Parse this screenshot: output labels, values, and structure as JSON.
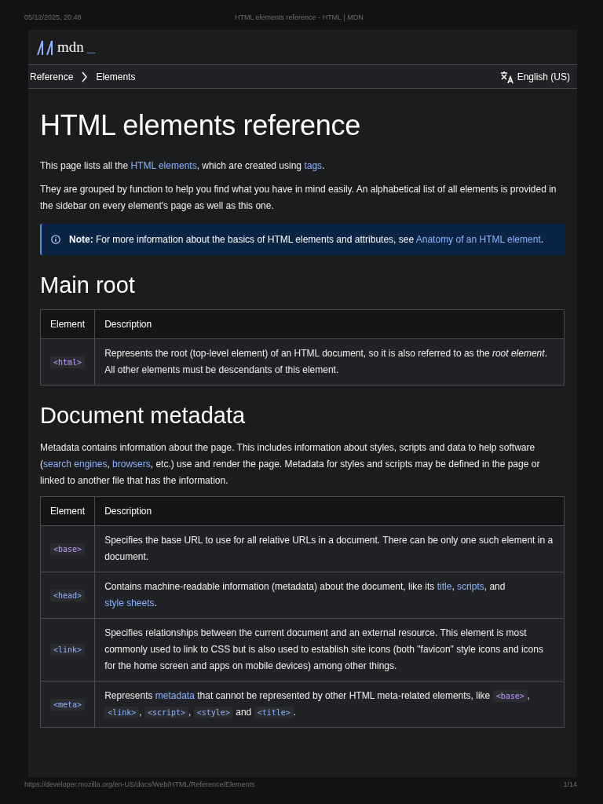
{
  "print_header": {
    "date": "05/12/2025, 20:48",
    "title": "HTML elements reference - HTML | MDN"
  },
  "site_header": {
    "logo_text": "mdn",
    "logo_cursor": "_"
  },
  "breadcrumbs": [
    {
      "label": "Reference"
    },
    {
      "label": "Elements"
    }
  ],
  "language": "English (US)",
  "title": "HTML elements reference",
  "intro": [
    [
      {
        "kind": "text",
        "text": "This page lists all the "
      },
      {
        "kind": "link",
        "text": "HTML elements",
        "visited": false
      },
      {
        "kind": "text",
        "text": ", which are created using "
      },
      {
        "kind": "link",
        "text": "tags",
        "visited": false
      },
      {
        "kind": "text",
        "text": "."
      }
    ],
    [
      {
        "kind": "text",
        "text": "They are grouped by function to help you find what you have in mind easily. An alphabetical list of all elements is provided in the sidebar on every element's page as well as this one."
      }
    ]
  ],
  "note": {
    "label": "Note:",
    "segments": [
      {
        "kind": "text",
        "text": " For more information about the basics of HTML elements and attributes, see "
      },
      {
        "kind": "link",
        "text": "Anatomy of an HTML element",
        "visited": false
      },
      {
        "kind": "text",
        "text": "."
      }
    ]
  },
  "sections": [
    {
      "heading": "Main root",
      "table": {
        "columns": [
          "Element",
          "Description"
        ],
        "rows": [
          {
            "element": {
              "text": "<html>",
              "visited": true
            },
            "description": [
              {
                "kind": "text",
                "text": "Represents the root (top-level element) of an HTML document, so it is also referred to as the "
              },
              {
                "kind": "em",
                "text": "root element"
              },
              {
                "kind": "text",
                "text": ". All other elements must be descendants of this element."
              }
            ]
          }
        ]
      }
    },
    {
      "heading": "Document metadata",
      "paragraphs": [
        [
          {
            "kind": "text",
            "text": "Metadata contains information about the page. This includes information about styles, scripts and data to help software ("
          },
          {
            "kind": "link",
            "text": "search engines",
            "visited": false
          },
          {
            "kind": "text",
            "text": ", "
          },
          {
            "kind": "link",
            "text": "browsers",
            "visited": false
          },
          {
            "kind": "text",
            "text": ", etc.) use and render the page. Metadata for styles and scripts may be defined in the page or linked to another file that has the information."
          }
        ]
      ],
      "table": {
        "columns": [
          "Element",
          "Description"
        ],
        "rows": [
          {
            "element": {
              "text": "<base>",
              "visited": true
            },
            "description": [
              {
                "kind": "text",
                "text": "Specifies the base URL to use for all relative URLs in a document. There can be only one such element in a document."
              }
            ]
          },
          {
            "element": {
              "text": "<head>",
              "visited": false
            },
            "description": [
              {
                "kind": "text",
                "text": "Contains machine-readable information (metadata) about the document, like its "
              },
              {
                "kind": "link",
                "text": "title",
                "visited": false
              },
              {
                "kind": "text",
                "text": ", "
              },
              {
                "kind": "link",
                "text": "scripts",
                "visited": false
              },
              {
                "kind": "text",
                "text": ", and "
              },
              {
                "kind": "link",
                "text": "style sheets",
                "visited": false
              },
              {
                "kind": "text",
                "text": "."
              }
            ]
          },
          {
            "element": {
              "text": "<link>",
              "visited": false
            },
            "description": [
              {
                "kind": "text",
                "text": "Specifies relationships between the current document and an external resource. This element is most commonly used to link to CSS but is also used to establish site icons (both \"favicon\" style icons and icons for the home screen and apps on mobile devices) among other things."
              }
            ]
          },
          {
            "element": {
              "text": "<meta>",
              "visited": false
            },
            "description": [
              {
                "kind": "text",
                "text": "Represents "
              },
              {
                "kind": "link",
                "text": "metadata",
                "visited": false
              },
              {
                "kind": "text",
                "text": " that cannot be represented by other HTML meta-related elements, like "
              },
              {
                "kind": "code",
                "text": "<base>",
                "visited": true
              },
              {
                "kind": "text",
                "text": ", "
              },
              {
                "kind": "code",
                "text": "<link>",
                "visited": false
              },
              {
                "kind": "text",
                "text": ", "
              },
              {
                "kind": "code",
                "text": "<script>",
                "visited": false
              },
              {
                "kind": "text",
                "text": ", "
              },
              {
                "kind": "code",
                "text": "<style>",
                "visited": false
              },
              {
                "kind": "text",
                "text": " and "
              },
              {
                "kind": "code",
                "text": "<title>",
                "visited": false
              },
              {
                "kind": "text",
                "text": "."
              }
            ]
          }
        ]
      }
    }
  ],
  "print_footer": {
    "url": "https://developer.mozilla.org/en-US/docs/Web/HTML/Reference/Elements",
    "page": "1/14"
  }
}
